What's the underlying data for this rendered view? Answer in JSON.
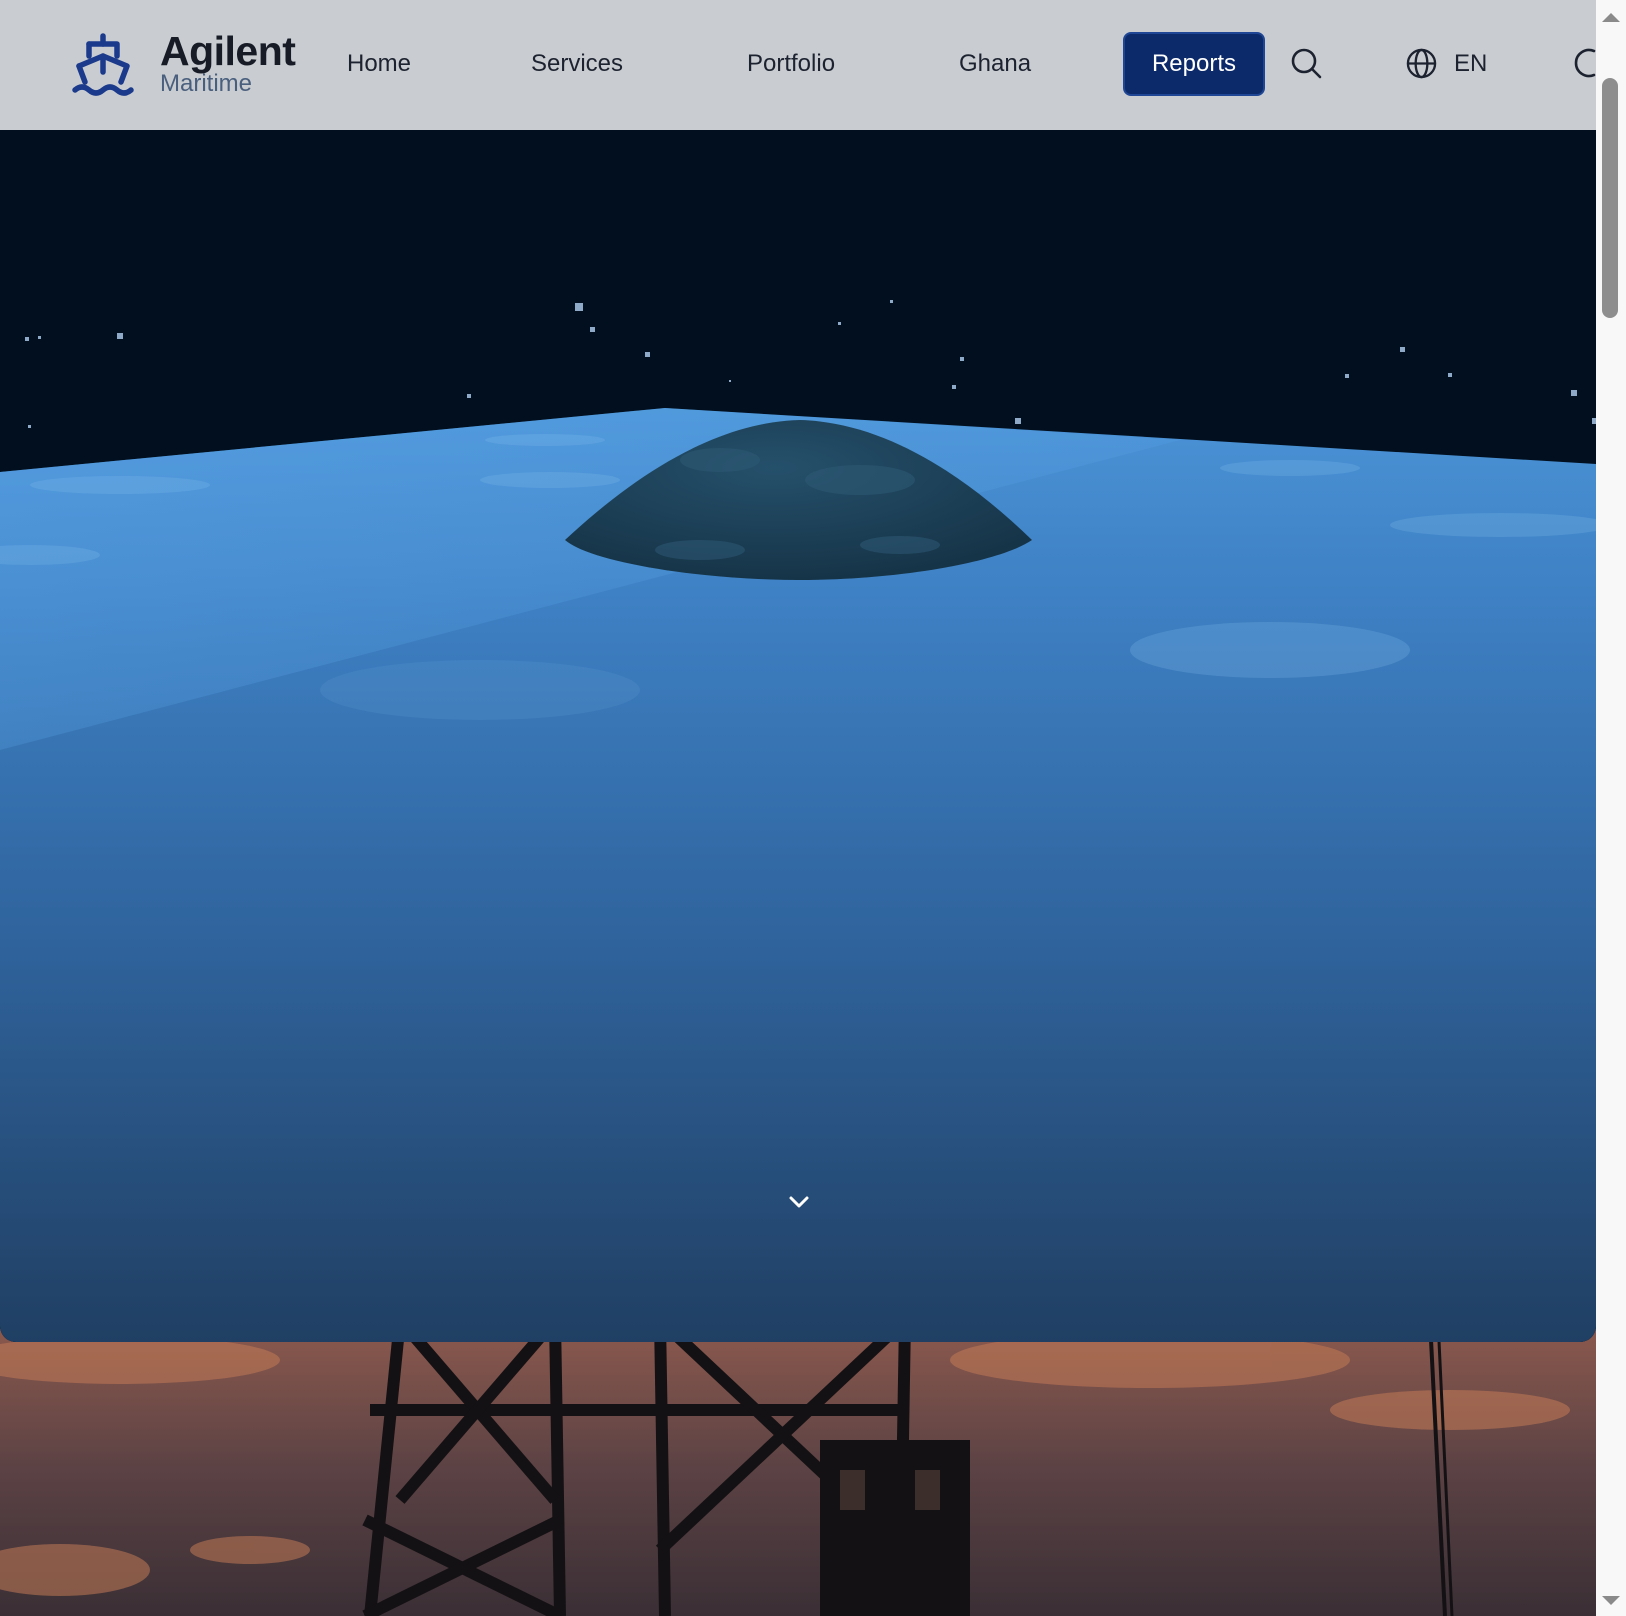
{
  "brand": {
    "name": "Agilent",
    "subtitle": "Maritime",
    "icon": "ship-icon"
  },
  "nav": {
    "items": [
      {
        "label": "Home"
      },
      {
        "label": "Services"
      },
      {
        "label": "Portfolio"
      },
      {
        "label": "Ghana"
      }
    ],
    "reports_label": "Reports",
    "search_icon": "search-icon",
    "language": {
      "icon": "globe-icon",
      "label": "EN"
    },
    "theme_icon": "moon-icon"
  },
  "hero": {
    "scroll_icon": "chevron-down-icon"
  },
  "colors": {
    "header_bg": "#c9cdd1",
    "accent": "#0c2a6a",
    "brand_sub": "#4a5f7e",
    "sky": "#020f1e",
    "ocean": "#3c7bc0"
  }
}
